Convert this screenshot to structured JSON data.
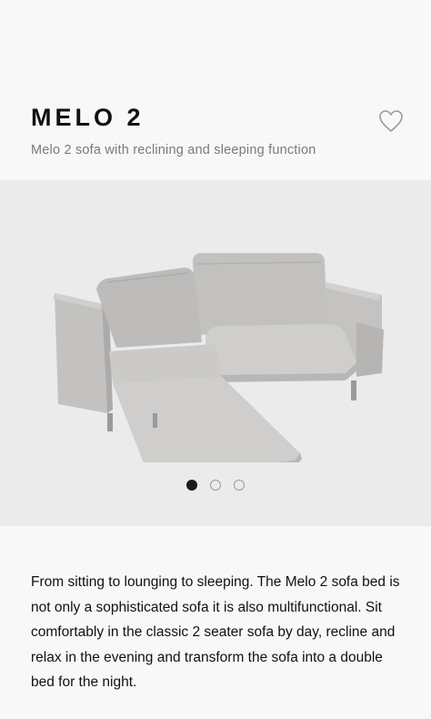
{
  "product": {
    "title": "MELO 2",
    "subtitle": "Melo 2 sofa with reclining and sleeping function",
    "favorite_icon": "heart-outline-icon"
  },
  "gallery": {
    "image": "sofa-product-image",
    "slide_count": 3,
    "active_slide": 1,
    "colors": {
      "background": "#ebebeb",
      "sofa": "#bdbcba"
    }
  },
  "description": {
    "text": "From sitting to lounging to sleeping. The Melo 2 sofa bed is not only a sophisticated sofa it is also multifunctional. Sit comfortably in the classic 2 seater sofa by day, recline and relax in the evening and transform the sofa into a double bed for the night."
  }
}
